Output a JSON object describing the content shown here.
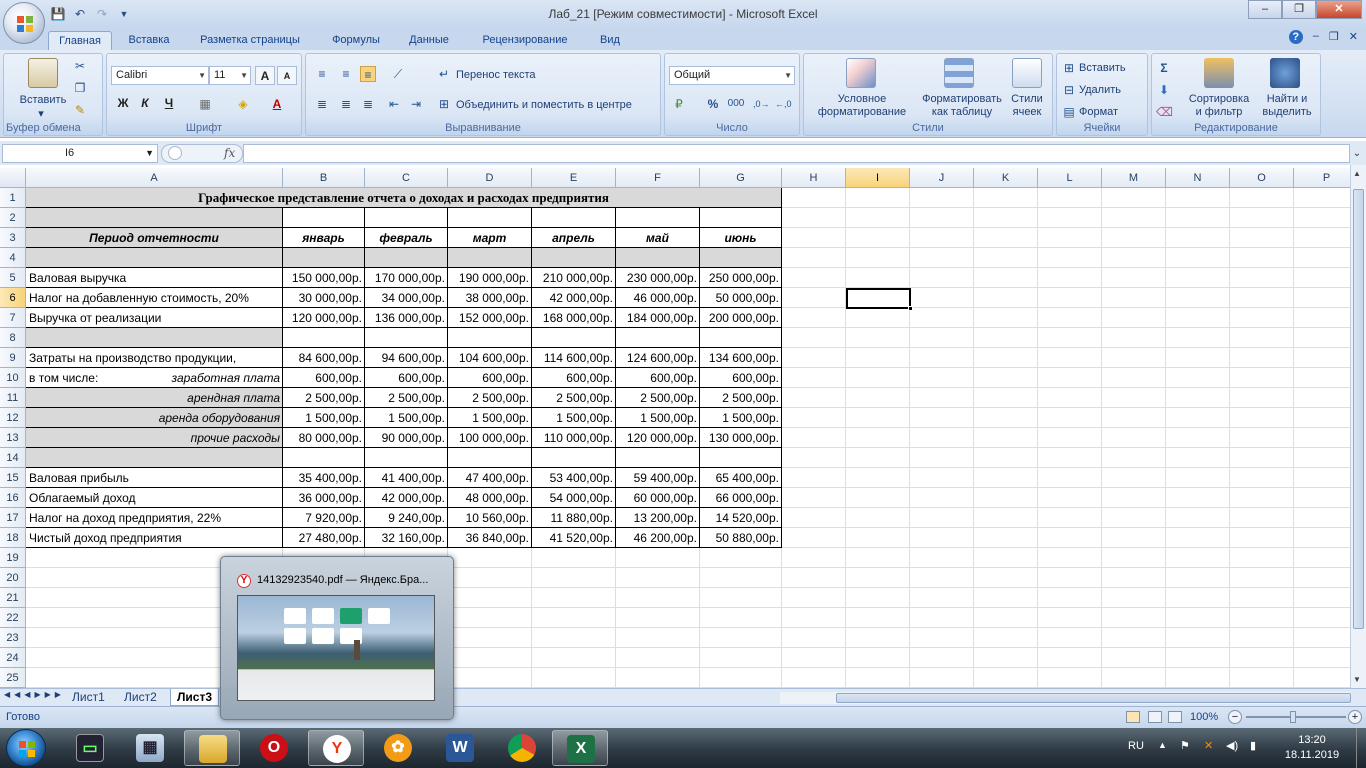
{
  "window": {
    "title": "Лаб_21  [Режим совместимости] - Microsoft Excel",
    "min": "–",
    "max": "❐",
    "close": "✕"
  },
  "ribbon_tabs": [
    "Главная",
    "Вставка",
    "Разметка страницы",
    "Формулы",
    "Данные",
    "Рецензирование",
    "Вид"
  ],
  "ribbon": {
    "clipboard": {
      "label": "Буфер обмена",
      "paste": "Вставить"
    },
    "font": {
      "label": "Шрифт",
      "family": "Calibri",
      "size": "11",
      "bold": "Ж",
      "italic": "К",
      "underline": "Ч",
      "grow": "A",
      "shrink": "A"
    },
    "alignment": {
      "label": "Выравнивание",
      "wrap": "Перенос текста",
      "merge": "Объединить и поместить в центре"
    },
    "number": {
      "label": "Число",
      "format": "Общий",
      "percent": "%",
      "thousands": "000"
    },
    "styles": {
      "label": "Стили",
      "conditional": "Условное форматирование",
      "as_table": "Форматировать как таблицу",
      "cell_styles": "Стили ячеек"
    },
    "cells": {
      "label": "Ячейки",
      "insert": "Вставить",
      "delete": "Удалить",
      "format": "Формат"
    },
    "editing": {
      "label": "Редактирование",
      "sort": "Сортировка и фильтр",
      "find": "Найти и выделить",
      "sigma": "Σ"
    }
  },
  "formula_bar": {
    "name_box": "I6",
    "fx": "fx",
    "value": ""
  },
  "columns": [
    "A",
    "B",
    "C",
    "D",
    "E",
    "F",
    "G",
    "H",
    "I",
    "J",
    "K",
    "L",
    "M",
    "N",
    "O",
    "P"
  ],
  "rows": [
    "1",
    "2",
    "3",
    "4",
    "5",
    "6",
    "7",
    "8",
    "9",
    "10",
    "11",
    "12",
    "13",
    "14",
    "15",
    "16",
    "17",
    "18",
    "19",
    "20",
    "21",
    "22",
    "23",
    "24",
    "25"
  ],
  "sheet": {
    "title": "Графическое представление отчета о доходах и расходах предприятия",
    "period_label": "Период отчетности",
    "months": [
      "январь",
      "февраль",
      "март",
      "апрель",
      "май",
      "июнь"
    ],
    "data_rows": [
      {
        "row": 5,
        "label": "Валовая выручка",
        "values": [
          "150 000,00р.",
          "170 000,00р.",
          "190 000,00р.",
          "210 000,00р.",
          "230 000,00р.",
          "250 000,00р."
        ]
      },
      {
        "row": 6,
        "label": "Налог на добавленную стоимость, 20%",
        "values": [
          "30 000,00р.",
          "34 000,00р.",
          "38 000,00р.",
          "42 000,00р.",
          "46 000,00р.",
          "50 000,00р."
        ]
      },
      {
        "row": 7,
        "label": "Выручка от реализации",
        "values": [
          "120 000,00р.",
          "136 000,00р.",
          "152 000,00р.",
          "168 000,00р.",
          "184 000,00р.",
          "200 000,00р."
        ]
      },
      {
        "row": 9,
        "label": "Затраты на производство продукции,",
        "values": [
          "84 600,00р.",
          "94 600,00р.",
          "104 600,00р.",
          "114 600,00р.",
          "124 600,00р.",
          "134 600,00р."
        ]
      },
      {
        "row": 10,
        "label": "в том числе:",
        "sublabel": "заработная плата",
        "values": [
          "600,00р.",
          "600,00р.",
          "600,00р.",
          "600,00р.",
          "600,00р.",
          "600,00р."
        ]
      },
      {
        "row": 11,
        "sublabel": "арендная   плата",
        "values": [
          "2 500,00р.",
          "2 500,00р.",
          "2 500,00р.",
          "2 500,00р.",
          "2 500,00р.",
          "2 500,00р."
        ]
      },
      {
        "row": 12,
        "sublabel": "аренда  оборудования",
        "values": [
          "1 500,00р.",
          "1 500,00р.",
          "1 500,00р.",
          "1 500,00р.",
          "1 500,00р.",
          "1 500,00р."
        ]
      },
      {
        "row": 13,
        "sublabel": "прочие   расходы",
        "values": [
          "80 000,00р.",
          "90 000,00р.",
          "100 000,00р.",
          "110 000,00р.",
          "120 000,00р.",
          "130 000,00р."
        ]
      },
      {
        "row": 15,
        "label": "Валовая прибыль",
        "values": [
          "35 400,00р.",
          "41 400,00р.",
          "47 400,00р.",
          "53 400,00р.",
          "59 400,00р.",
          "65 400,00р."
        ]
      },
      {
        "row": 16,
        "label": "Облагаемый доход",
        "values": [
          "36 000,00р.",
          "42 000,00р.",
          "48 000,00р.",
          "54 000,00р.",
          "60 000,00р.",
          "66 000,00р."
        ]
      },
      {
        "row": 17,
        "label": "Налог на доход предприятия, 22%",
        "values": [
          "7 920,00р.",
          "9 240,00р.",
          "10 560,00р.",
          "11 880,00р.",
          "13 200,00р.",
          "14 520,00р."
        ]
      },
      {
        "row": 18,
        "label": "Чистый доход предприятия",
        "values": [
          "27 480,00р.",
          "32 160,00р.",
          "36 840,00р.",
          "41 520,00р.",
          "46 200,00р.",
          "50 880,00р."
        ]
      }
    ]
  },
  "sheet_tabs": [
    "Лист1",
    "Лист2",
    "Лист3"
  ],
  "status": {
    "ready": "Готово",
    "zoom": "100%"
  },
  "taskbar": {
    "lang": "RU",
    "time": "13:20",
    "date": "18.11.2019",
    "apps": [
      "start",
      "terminal",
      "calculator",
      "explorer",
      "opera",
      "yandex",
      "settings",
      "word",
      "chrome",
      "excel"
    ]
  },
  "thumbnail": {
    "title": "14132923540.pdf — Яндекс.Бра..."
  },
  "colors": {
    "accent": "#15428b",
    "header_gray": "#d9d9d9",
    "selection": "#f8d379"
  }
}
